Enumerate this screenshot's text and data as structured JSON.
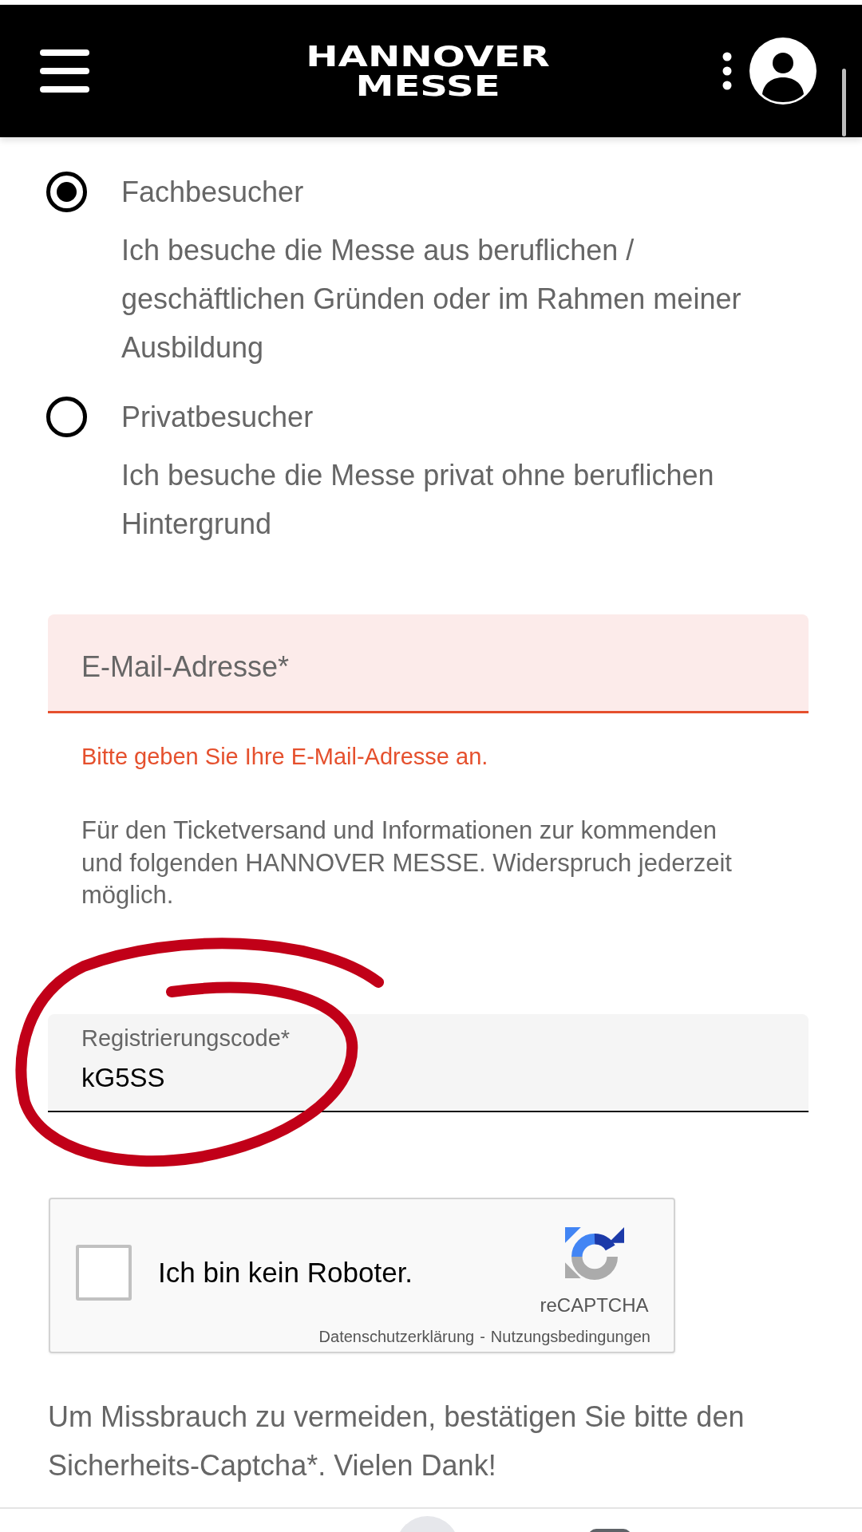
{
  "header": {
    "logo": "HANNOVER MESSE"
  },
  "visitor_types": [
    {
      "label": "Fachbesucher",
      "description": "Ich besuche die Messe aus beruflichen / geschäftlichen Gründen oder im Rahmen meiner Ausbildung",
      "selected": true
    },
    {
      "label": "Privatbesucher",
      "description": "Ich besuche die Messe privat ohne beruflichen Hintergrund",
      "selected": false
    }
  ],
  "email_field": {
    "placeholder": "E-Mail-Adresse*",
    "invalid": true,
    "error": "Bitte geben Sie Ihre E-Mail-Adresse an."
  },
  "email_note": "Für den Ticketversand und Informationen zur kommenden und folgenden HANNOVER MESSE. Widerspruch jederzeit möglich.",
  "registration_code_field": {
    "label": "Registrierungscode*",
    "value": "kG5SS"
  },
  "annotation": {
    "kind": "circle"
  },
  "captcha": {
    "label": "Ich bin kein Roboter.",
    "checked": false,
    "brand": "reCAPTCHA",
    "links": [
      "Datenschutzerklärung",
      "Nutzungsbedingungen"
    ],
    "link_separator": "-"
  },
  "captcha_hint": "Um Missbrauch zu vermeiden, bestätigen Sie bitte den Sicherheits-Captcha*. Vielen Dank!"
}
